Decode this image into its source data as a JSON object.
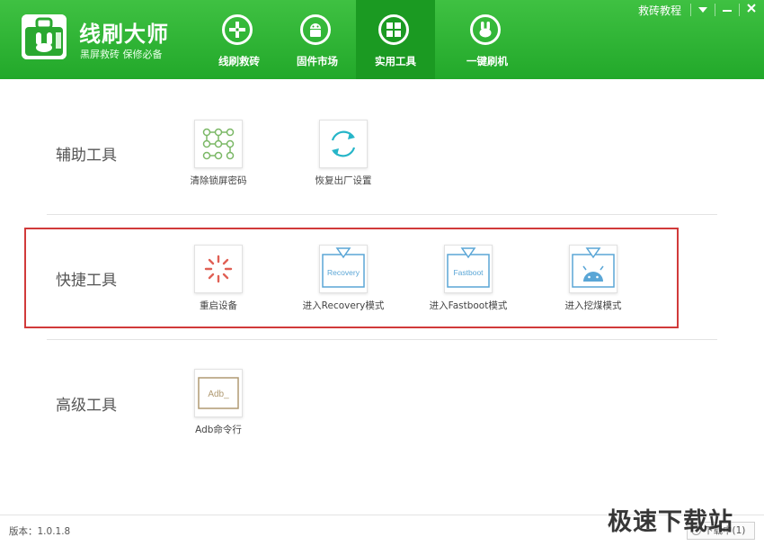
{
  "header": {
    "app_title": "线刷大师",
    "app_subtitle": "黑屏救砖  保修必备",
    "tutorial_link": "救砖教程",
    "tabs": [
      {
        "label": "线刷救砖"
      },
      {
        "label": "固件市场"
      },
      {
        "label": "实用工具",
        "active": true
      },
      {
        "label": "一键刷机"
      }
    ]
  },
  "sections": {
    "auxiliary": {
      "title": "辅助工具",
      "tools": [
        {
          "label": "清除锁屏密码",
          "icon": "pattern-lock-icon"
        },
        {
          "label": "恢复出厂设置",
          "icon": "refresh-icon"
        }
      ]
    },
    "quick": {
      "title": "快捷工具",
      "tools": [
        {
          "label": "重启设备",
          "icon": "reboot-spinner-icon"
        },
        {
          "label": "进入Recovery模式",
          "icon": "recovery-icon",
          "icon_text": "Recovery"
        },
        {
          "label": "进入Fastboot模式",
          "icon": "fastboot-icon",
          "icon_text": "Fastboot"
        },
        {
          "label": "进入挖煤模式",
          "icon": "android-icon"
        }
      ]
    },
    "advanced": {
      "title": "高级工具",
      "tools": [
        {
          "label": "Adb命令行",
          "icon": "adb-terminal-icon",
          "icon_text": "Adb_"
        }
      ]
    }
  },
  "footer": {
    "version": "版本：1.0.1.8",
    "download_status": "下载中(1)"
  },
  "watermark": "极速下载站",
  "colors": {
    "brand_green": "#2db533",
    "active_tab": "#1b9a22",
    "highlight_red": "#d13a3a",
    "icon_blue": "#5aa6d6",
    "icon_green": "#7bb866",
    "icon_cyan": "#26b5c8",
    "icon_red": "#e06055",
    "icon_brown": "#b09a72"
  }
}
